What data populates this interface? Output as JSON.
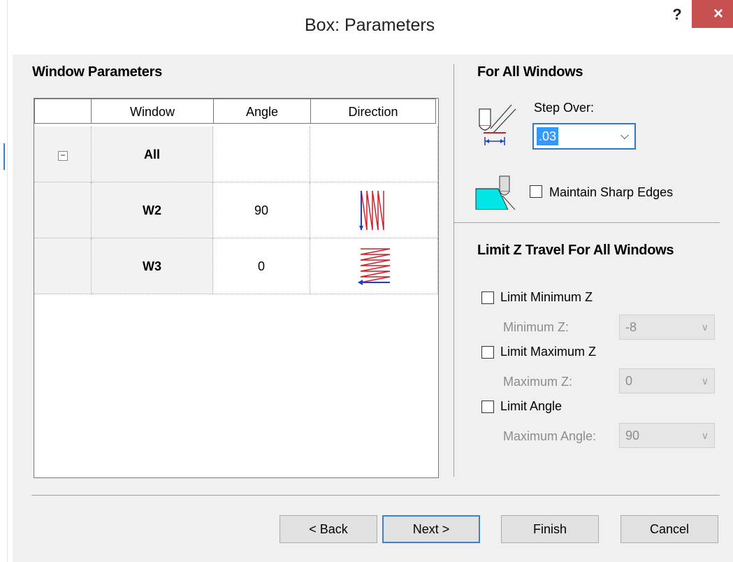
{
  "dialog": {
    "title": "Box: Parameters",
    "help_label": "?",
    "close_label": "×"
  },
  "window_parameters": {
    "heading": "Window Parameters",
    "columns": [
      "Window",
      "Angle",
      "Direction"
    ],
    "rows": [
      {
        "window": "All",
        "angle": "",
        "direction": "",
        "expander": "−"
      },
      {
        "window": "W2",
        "angle": "90",
        "direction": "zigzag-vertical-icon"
      },
      {
        "window": "W3",
        "angle": "0",
        "direction": "zigzag-horizontal-icon"
      }
    ]
  },
  "for_all_windows": {
    "heading": "For All Windows",
    "step_over_label": "Step Over:",
    "step_over_value": ".03",
    "maintain_sharp_edges_label": "Maintain Sharp Edges",
    "maintain_sharp_edges_checked": false
  },
  "limit_z": {
    "heading": "Limit Z Travel For All Windows",
    "limit_min_label": "Limit Minimum Z",
    "min_z_label": "Minimum Z:",
    "min_z_value": "-8",
    "limit_max_label": "Limit Maximum Z",
    "max_z_label": "Maximum Z:",
    "max_z_value": "0",
    "limit_angle_label": "Limit Angle",
    "max_angle_label": "Maximum Angle:",
    "max_angle_value": "90"
  },
  "buttons": {
    "back": "< Back",
    "next": "Next >",
    "finish": "Finish",
    "cancel": "Cancel"
  },
  "colors": {
    "close": "#c75050",
    "focus": "#3377cc",
    "selection": "#3399ff",
    "zigzag_red": "#d0202a",
    "zigzag_blue": "#1a3fd0",
    "tool_cyan": "#00e5e5"
  }
}
